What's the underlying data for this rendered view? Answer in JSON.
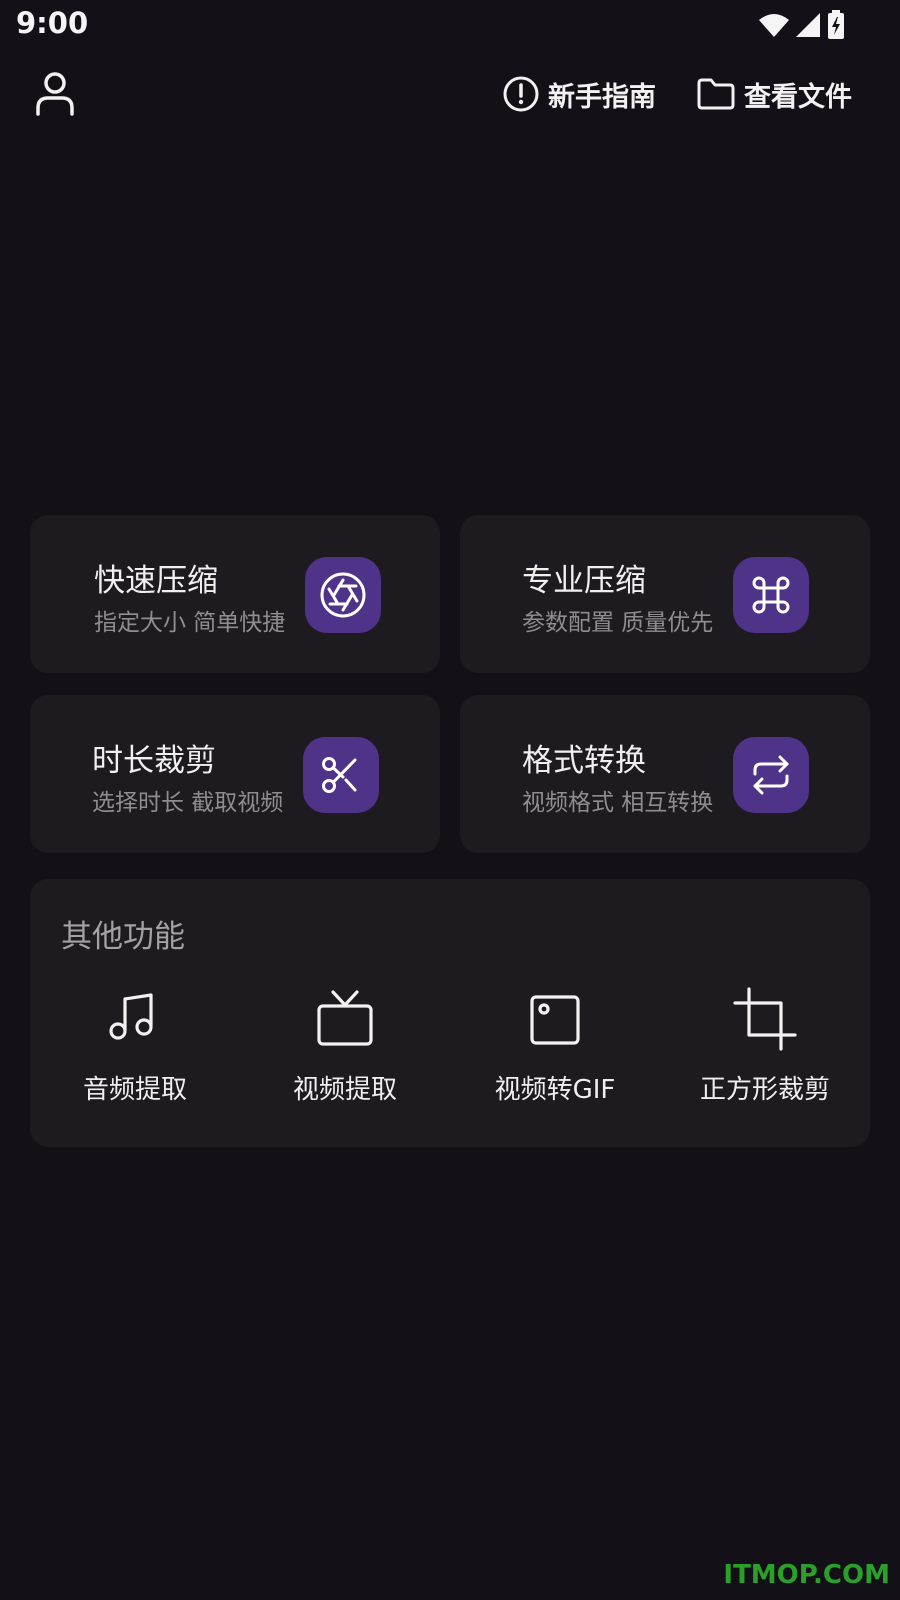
{
  "status_bar": {
    "time": "9:00",
    "icons": [
      "wifi-icon",
      "cell-signal-icon",
      "battery-charging-icon"
    ]
  },
  "top_bar": {
    "profile_icon": "user-icon",
    "guide": {
      "label": "新手指南",
      "icon": "info-circle-icon"
    },
    "files": {
      "label": "查看文件",
      "icon": "folder-icon"
    }
  },
  "cards": [
    {
      "title": "快速压缩",
      "subtitle": "指定大小 简单快捷",
      "icon": "aperture-icon"
    },
    {
      "title": "专业压缩",
      "subtitle": "参数配置 质量优先",
      "icon": "command-icon"
    },
    {
      "title": "时长裁剪",
      "subtitle": "选择时长 截取视频",
      "icon": "scissors-icon"
    },
    {
      "title": "格式转换",
      "subtitle": "视频格式 相互转换",
      "icon": "repeat-icon"
    }
  ],
  "other": {
    "title": "其他功能",
    "tools": [
      {
        "label": "音频提取",
        "icon": "music-note-icon"
      },
      {
        "label": "视频提取",
        "icon": "tv-icon"
      },
      {
        "label": "视频转GIF",
        "icon": "image-frame-icon"
      },
      {
        "label": "正方形裁剪",
        "icon": "crop-icon"
      }
    ]
  },
  "watermark": "ITMOP.COM",
  "colors": {
    "background": "#131018",
    "card": "#1d1b20",
    "accent": "#4f3389",
    "watermark": "#2aa02a"
  }
}
